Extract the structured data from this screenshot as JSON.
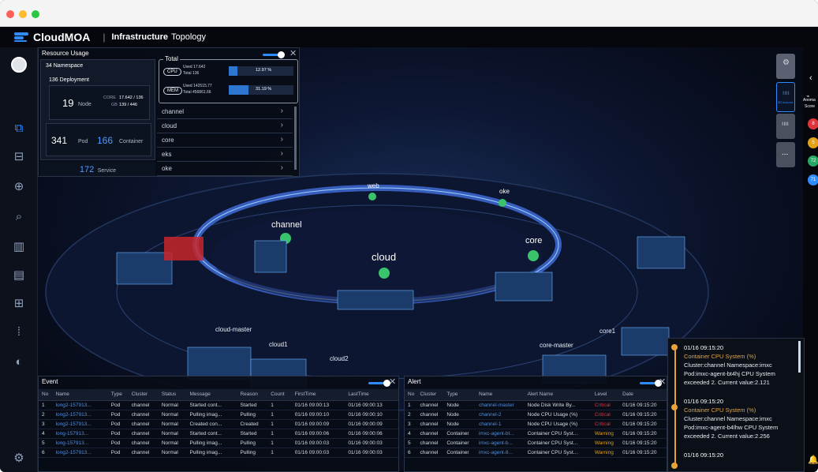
{
  "app": {
    "brand": "CloudMOA",
    "separator": "|",
    "title_bold": "Infrastructure",
    "title_rest": "Topology"
  },
  "resource_usage": {
    "title": "Resource Usage",
    "namespace": {
      "count": "34",
      "label": "Namespace"
    },
    "deployment": {
      "count": "136",
      "label": "Deployment"
    },
    "node": {
      "count": "19",
      "label": "Node",
      "core_label": "CORE",
      "core_value": "17.642 / 136",
      "gb_label": "GB",
      "gb_value": "139 / 446"
    },
    "pod": {
      "count": "341",
      "label": "Pod"
    },
    "container": {
      "count": "166",
      "label": "Container"
    },
    "service": {
      "count": "172",
      "label": "Service"
    },
    "total": {
      "title": "Total",
      "cpu": {
        "label": "CPU",
        "used_label": "Used",
        "used": "17.642",
        "total_label": "Total",
        "total": "136",
        "percent": "12.97 %",
        "fill": 0.13
      },
      "mem": {
        "label": "MEM",
        "used_label": "Used",
        "used": "142515.77",
        "total_label": "Total",
        "total": "456861.66",
        "percent": "31.19 %",
        "fill": 0.31
      }
    },
    "namespaces": [
      "channel",
      "cloud",
      "core",
      "eks",
      "oke"
    ]
  },
  "topology": {
    "ring_labels": {
      "web": "web",
      "oke": "oke",
      "channel": "channel",
      "core": "core",
      "cloud": "cloud"
    },
    "clusters": {
      "c1": "cloud-master",
      "c2": "cloud1",
      "c3": "cloud2",
      "c4": "core-master",
      "c5": "core1"
    }
  },
  "event": {
    "title": "Event",
    "columns": [
      "No",
      "Name",
      "Type",
      "Cluster",
      "Status",
      "Message",
      "Reason",
      "Count",
      "FirstTime",
      "LastTime"
    ],
    "rows": [
      [
        "1",
        "long2-157913...",
        "Pod",
        "channel",
        "Normal",
        "Started cont...",
        "Started",
        "1",
        "01/16 09:00:13",
        "01/16 09:00:13"
      ],
      [
        "2",
        "long2-157913...",
        "Pod",
        "channel",
        "Normal",
        "Pulling imag...",
        "Pulling",
        "1",
        "01/16 09:00:10",
        "01/16 09:00:10"
      ],
      [
        "3",
        "long2-157913...",
        "Pod",
        "channel",
        "Normal",
        "Created con...",
        "Created",
        "1",
        "01/16 09:00:09",
        "01/16 09:00:09"
      ],
      [
        "4",
        "long-157913...",
        "Pod",
        "channel",
        "Normal",
        "Started cont...",
        "Started",
        "1",
        "01/16 09:00:06",
        "01/16 09:00:06"
      ],
      [
        "5",
        "long-157913...",
        "Pod",
        "channel",
        "Normal",
        "Pulling imag...",
        "Pulling",
        "1",
        "01/16 09:00:03",
        "01/16 09:00:03"
      ],
      [
        "6",
        "long2-157913...",
        "Pod",
        "channel",
        "Normal",
        "Pulling imag...",
        "Pulling",
        "1",
        "01/16 09:00:03",
        "01/16 09:00:03"
      ]
    ]
  },
  "alert": {
    "title": "Alert",
    "columns": [
      "No",
      "Cluster",
      "Type",
      "Name",
      "Alert Name",
      "Level",
      "Date"
    ],
    "rows": [
      [
        "1",
        "channel",
        "Node",
        "channel-master",
        "Node Disk Write By...",
        "Critical",
        "01/16 09:15:20"
      ],
      [
        "2",
        "channel",
        "Node",
        "channel-2",
        "Node CPU Usage (%)",
        "Critical",
        "01/16 09:15:20"
      ],
      [
        "3",
        "channel",
        "Node",
        "channel-1",
        "Node CPU Usage (%)",
        "Critical",
        "01/16 09:15:20"
      ],
      [
        "4",
        "channel",
        "Container",
        "imxc-agent-bt...",
        "Container CPU Syst...",
        "Warning",
        "01/16 09:15:20"
      ],
      [
        "5",
        "channel",
        "Container",
        "imxc-agent-b...",
        "Container CPU Syst...",
        "Warning",
        "01/16 09:15:20"
      ],
      [
        "6",
        "channel",
        "Container",
        "imxc-agent-8...",
        "Container CPU Syst...",
        "Warning",
        "01/16 09:15:20"
      ]
    ]
  },
  "notifications": [
    {
      "time": "01/16 09:15:20",
      "title": "Container CPU System (%)",
      "line1": "Cluster:channel Namespace:imxc",
      "line2": "Pod:imxc-agent-bt4hj CPU System",
      "line3": "exceeded 2. Current value:2.121"
    },
    {
      "time": "01/16 09:15:20",
      "title": "Container CPU System (%)",
      "line1": "Cluster:channel Namespace:imxc",
      "line2": "Pod:imxc-agent-b4lhw CPU System",
      "line3": "exceeded 2. Current value:2.256"
    },
    {
      "time": "01/16 09:15:20"
    }
  ],
  "controls": {
    "view_3d": "3D Around",
    "more": "..."
  },
  "right_panel": {
    "label1": "Anoma",
    "label2": "Score",
    "badges": [
      "8",
      "5",
      "72",
      "71"
    ]
  },
  "colors": {
    "accent": "#2f8cff",
    "critical": "#e0343d",
    "warning": "#e2a11b",
    "notif": "#e6a33a"
  }
}
